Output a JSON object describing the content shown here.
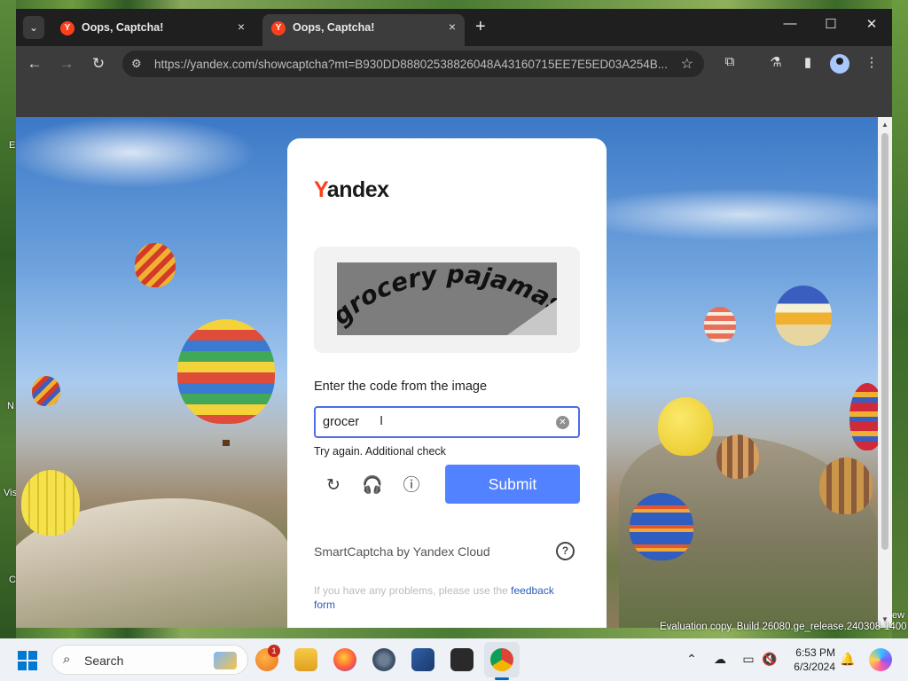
{
  "desktop": {
    "left_labels": [
      "E",
      "N",
      "Vis",
      "C"
    ],
    "right_label": "ew"
  },
  "browser": {
    "tabs": [
      {
        "title": "Oops, Captcha!",
        "favicon": "Y",
        "active": false
      },
      {
        "title": "Oops, Captcha!",
        "favicon": "Y",
        "active": true
      }
    ],
    "tab_close": "×",
    "new_tab": "+",
    "url": "https://yandex.com/showcaptcha?mt=B930DD88802538826048A43160715EE7E5ED03A254B...",
    "window_controls": {
      "minimize": "—",
      "maximize": "☐",
      "close": "✕"
    }
  },
  "captcha": {
    "logo_first": "Y",
    "logo_rest": "andex",
    "image_text": "grocery pajamas",
    "prompt": "Enter the code from the image",
    "input_value": "grocer",
    "error": "Try again. Additional check",
    "submit": "Submit",
    "provider": "SmartCaptcha by Yandex Cloud",
    "help": "?",
    "problem_prefix": "If you have any problems, please use the",
    "problem_link": "feedback form"
  },
  "os": {
    "watermark": "Evaluation copy. Build 26080.ge_release.240308-1400",
    "search_placeholder": "Search",
    "notification_count": "1",
    "time": "6:53 PM",
    "date": "6/3/2024"
  },
  "colors": {
    "accent": "#5282ff",
    "yandex_red": "#fc3f1d",
    "input_border": "#4f6ce8",
    "link": "#2d5bb9"
  }
}
